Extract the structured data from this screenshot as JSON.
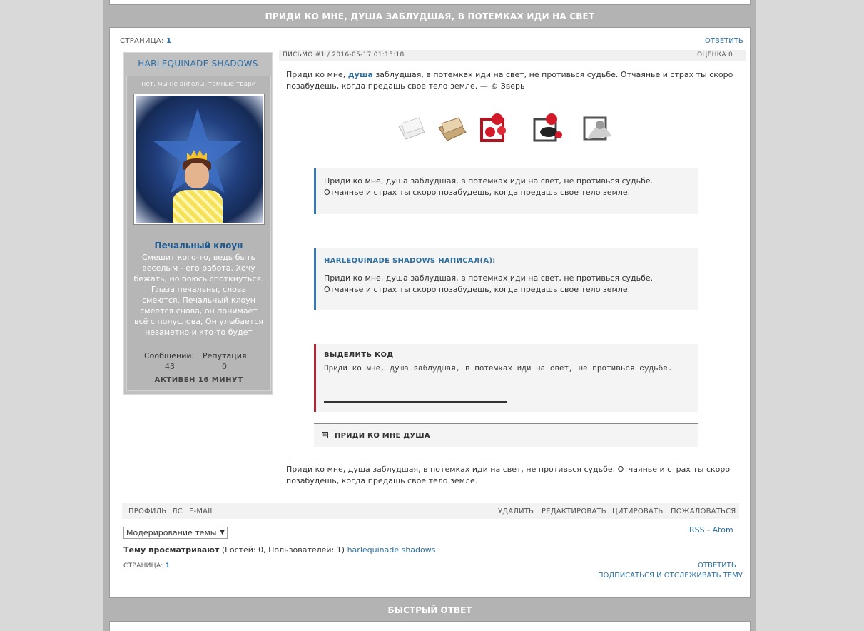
{
  "topic_title": "ПРИДИ КО МНЕ, ДУША ЗАБЛУДШАЯ, В ПОТЕМКАХ ИДИ НА СВЕТ",
  "quick_reply_title": "БЫСТРЫЙ ОТВЕТ",
  "pagination_top": {
    "label": "СТРАНИЦА:",
    "page": "1"
  },
  "reply_top": "ОТВЕТИТЬ",
  "profile": {
    "name": "HARLEQUINADE SHADOWS",
    "status": "нет, мы не ангелы. темные твари",
    "signature_title": "Печальный клоун",
    "signature_text": "Смешит кого-то, ведь быть веселым - его работа. Хочу бежать, но боюсь споткнуться. Глаза печальны, слова смеются. Печальный клоун смеется снова, он понимает всё с полуслова, Он улыбается незаметно и кто-то будет смертельно бледным.",
    "posts_label": "Сообщений:",
    "posts_value": "43",
    "rep_label": "Репутация:",
    "rep_value": "0",
    "active": "АКТИВЕН 16 МИНУТ"
  },
  "post": {
    "header": "ПИСЬМО #1 / 2016-05-17 01:15:18",
    "rating": "ОЦЕНКА 0",
    "text_before": "Приди ко мне, ",
    "text_link": "душа",
    "text_after": " заблудшая, в потемках иди на свет, не противься судьбе. Отчаянье и страх ты скоро позабудешь, когда предашь свое тело земле. — © Зверь",
    "quote1": "Приди ко мне, душа заблудшая, в потемках иди на свет, не противься судьбе. Отчаянье и страх ты скоро позабудешь, когда предашь свое тело земле.",
    "quote2_title": "HARLEQUINADE SHADOWS НАПИСАЛ(А):",
    "quote2": "Приди ко мне, душа заблудшая, в потемках иди на свет, не противься судьбе. Отчаянье и страх ты скоро позабудешь, когда предашь свое тело земле.",
    "code_title": "ВЫДЕЛИТЬ КОД",
    "code": "Приди ко мне, душа заблудшая, в потемках иди на свет, не противься судьбе.",
    "spoiler_icon": "⊞",
    "spoiler_title": "ПРИДИ КО МНЕ ДУША",
    "bottom_text": "Приди ко мне, душа заблудшая, в потемках иди на свет, не противься судьбе. Отчаянье и страх ты скоро позабудешь, когда предашь свое тело земле."
  },
  "post_links": {
    "profile": "ПРОФИЛЬ",
    "pm": "ЛС",
    "email": "E-MAIL",
    "delete": "УДАЛИТЬ",
    "edit": "РЕДАКТИРОВАТЬ",
    "quote": "ЦИТИРОВАТЬ",
    "report": "ПОЖАЛОВАТЬСЯ"
  },
  "moderation_select": "Модерирование темы",
  "feeds": {
    "rss": "RSS",
    "sep": " - ",
    "atom": "Atom"
  },
  "viewers": {
    "label": "Тему просматривают",
    "counts": " (Гостей: 0, Пользователей: 1) ",
    "user": "harlequinade shadows"
  },
  "pagination_bottom": {
    "label": "СТРАНИЦА:",
    "page": "1"
  },
  "reply_bottom": "ОТВЕТИТЬ",
  "subscribe": "ПОДПИСАТЬСЯ И ОТСЛЕЖИВАТЬ ТЕМУ",
  "colors": {
    "accent": "#2f6f9f",
    "code_border": "#b92433",
    "frame": "#b3b3b3"
  }
}
